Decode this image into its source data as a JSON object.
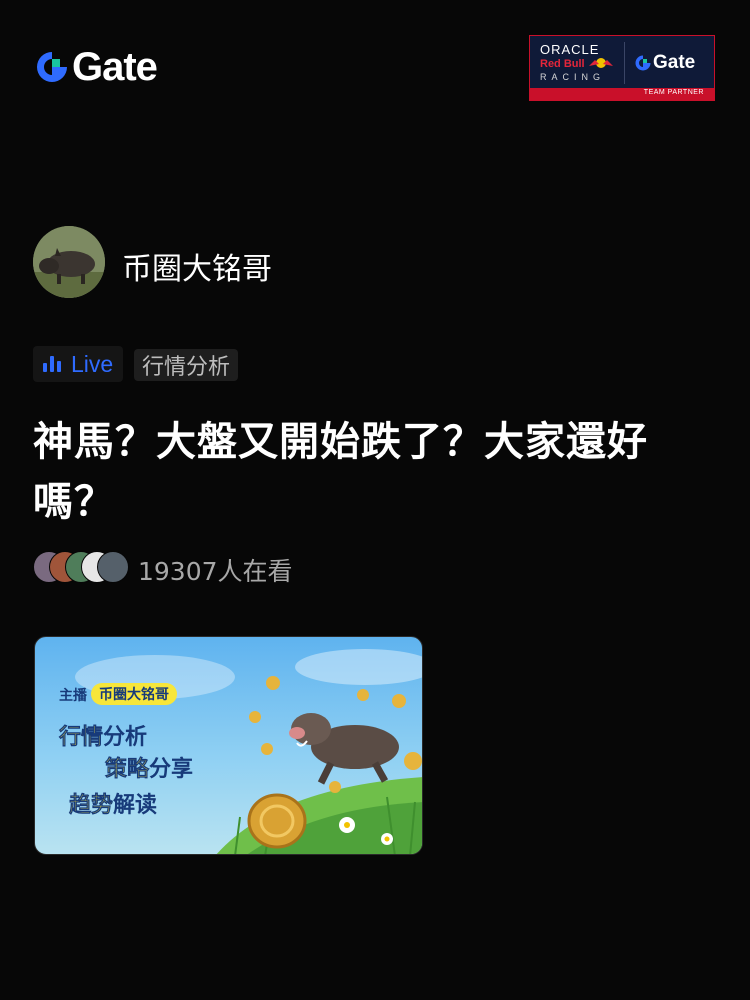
{
  "header": {
    "brand": "Gate",
    "partner": {
      "oracle": "ORACLE",
      "redbull": "Red Bull",
      "racing": "RACING",
      "brand": "Gate",
      "label": "TEAM PARTNER"
    }
  },
  "streamer": {
    "name": "币圈大铭哥"
  },
  "tags": {
    "live": "Live",
    "category": "行情分析"
  },
  "title": "神馬？大盤又開始跌了？大家還好嗎？",
  "viewers": {
    "text": "19307人在看"
  },
  "banner": {
    "host_label": "主播",
    "host_name": "币圈大铭哥",
    "line1_highlight": "行情",
    "line1_rest": "分析",
    "line2_highlight": "策略",
    "line2_rest": "分享",
    "line3_highlight": "趋势",
    "line3_rest": "解读"
  },
  "colors": {
    "background": "#070707",
    "accent": "#2f6bff",
    "brand_teal": "#18c5a1",
    "partner_red": "#c9102a"
  }
}
